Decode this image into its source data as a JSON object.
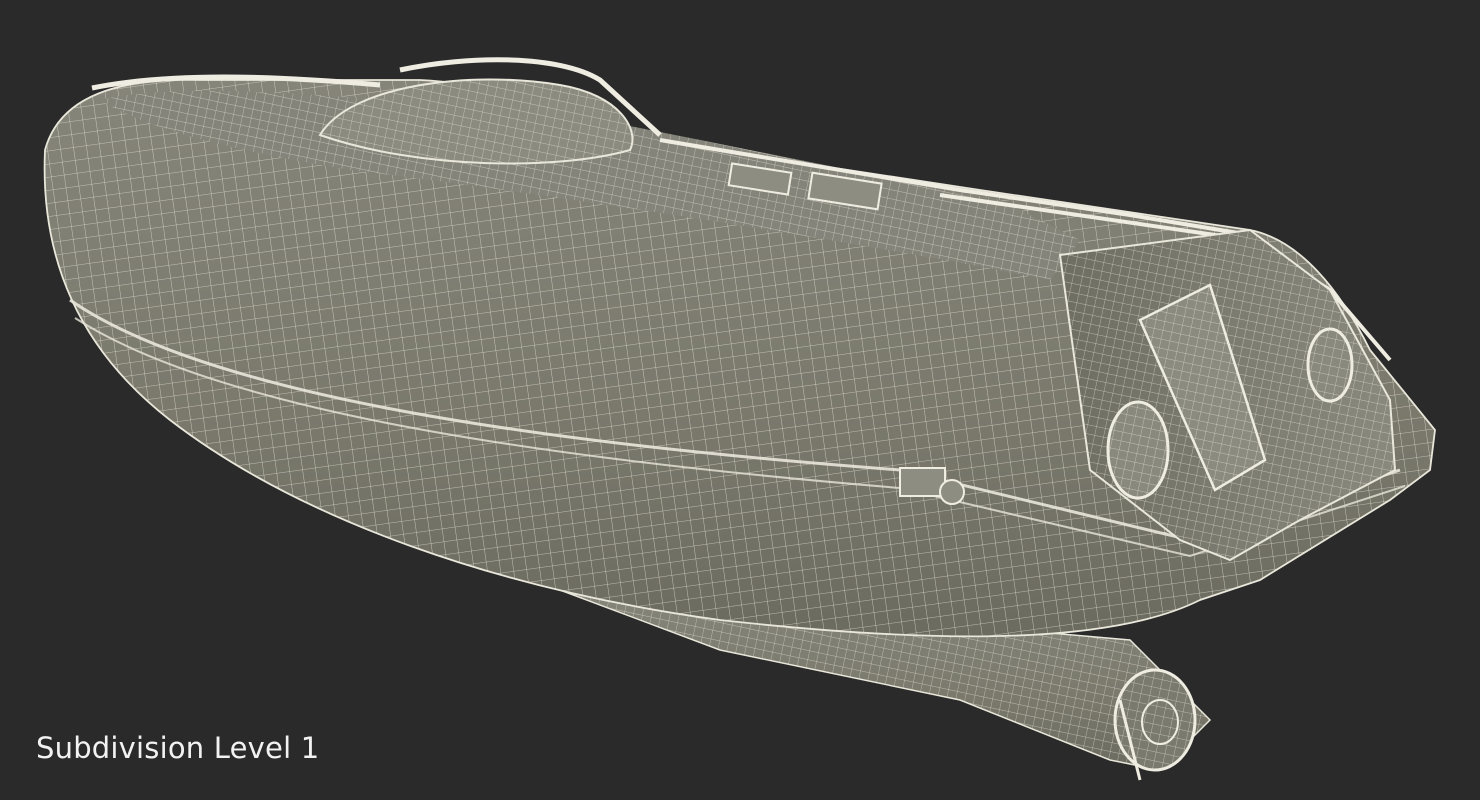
{
  "caption": {
    "text": "Subdivision Level 1"
  },
  "scene": {
    "subject": "lifeboat-wireframe-model",
    "background_color": "#2a2a2a",
    "hull_color": "#7b7a6c",
    "wire_color": "#e9e6da"
  }
}
